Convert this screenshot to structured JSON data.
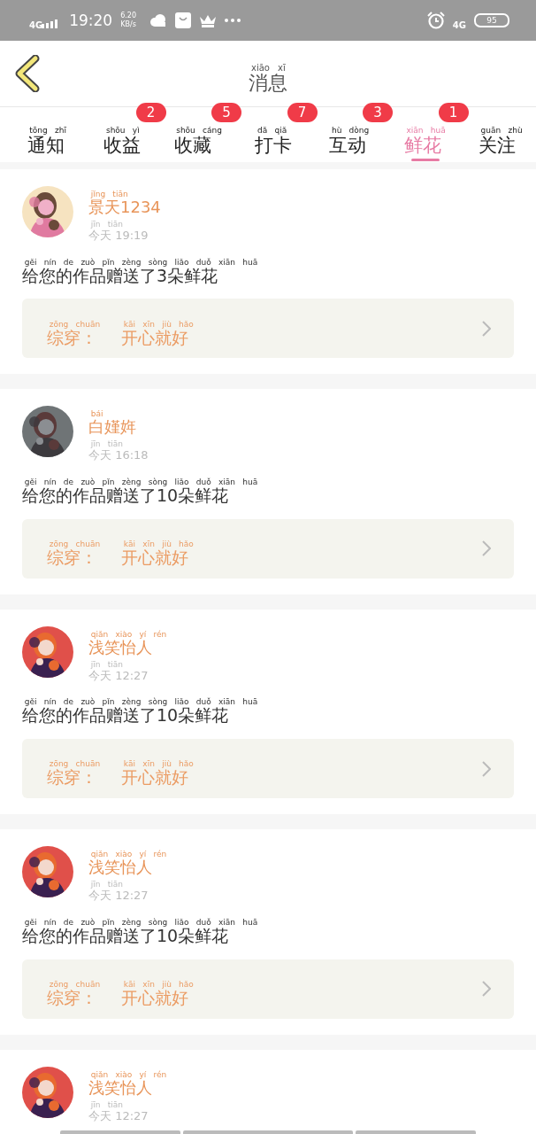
{
  "status_bar": {
    "network": "4G",
    "time": "19:20",
    "speed": "6.20",
    "speed_unit": "KB/s",
    "network_right": "4G",
    "battery": "95"
  },
  "header": {
    "title": "消息",
    "title_pinyin": "xiāo xī"
  },
  "tabs": [
    {
      "label": "通知",
      "pinyin": "tōng zhī",
      "selected": false
    },
    {
      "label": "收益",
      "pinyin": "shōu yì",
      "badge": "2",
      "selected": false
    },
    {
      "label": "收藏",
      "pinyin": "shōu cáng",
      "badge": "5",
      "selected": false
    },
    {
      "label": "打卡",
      "pinyin": "dǎ qiǎ",
      "badge": "7",
      "selected": false
    },
    {
      "label": "互动",
      "pinyin": "hù dòng",
      "badge": "3",
      "selected": false
    },
    {
      "label": "鲜花",
      "pinyin": "xiān huā",
      "badge": "1",
      "selected": true
    },
    {
      "label": "关注",
      "pinyin": "guān zhù",
      "selected": false
    }
  ],
  "messages": [
    {
      "name": "景天1234",
      "name_pinyin": "jǐng tiān",
      "time": "今天 19:19",
      "time_pinyin": "jīn tiān",
      "text": "给您的作品赠送了3朵鲜花",
      "text_pinyin": "gěi nín de zuò pǐn zèng sòng liǎo duǒ xiān huā",
      "work_label": "综穿：",
      "work_label_pinyin": "zōng chuān",
      "work_title": "开心就好",
      "work_title_pinyin": "kāi xīn jiù hǎo"
    },
    {
      "name": "白嫤姩",
      "name_pinyin": "bái",
      "time": "今天 16:18",
      "time_pinyin": "jīn tiān",
      "text": "给您的作品赠送了10朵鲜花",
      "text_pinyin": "gěi nín de zuò pǐn zèng sòng liǎo duǒ xiān huā",
      "work_label": "综穿：",
      "work_label_pinyin": "zōng chuān",
      "work_title": "开心就好",
      "work_title_pinyin": "kāi xīn jiù hǎo"
    },
    {
      "name": "浅笑怡人",
      "name_pinyin": "qiǎn xiào yí rén",
      "time": "今天 12:27",
      "time_pinyin": "jīn tiān",
      "text": "给您的作品赠送了10朵鲜花",
      "text_pinyin": "gěi nín de zuò pǐn zèng sòng liǎo duǒ xiān huā",
      "work_label": "综穿：",
      "work_label_pinyin": "zōng chuān",
      "work_title": "开心就好",
      "work_title_pinyin": "kāi xīn jiù hǎo"
    },
    {
      "name": "浅笑怡人",
      "name_pinyin": "qiǎn xiào yí rén",
      "time": "今天 12:27",
      "time_pinyin": "jīn tiān",
      "text": "给您的作品赠送了10朵鲜花",
      "text_pinyin": "gěi nín de zuò pǐn zèng sòng liǎo duǒ xiān huā",
      "work_label": "综穿：",
      "work_label_pinyin": "zōng chuān",
      "work_title": "开心就好",
      "work_title_pinyin": "kāi xīn jiù hǎo"
    },
    {
      "name": "浅笑怡人",
      "name_pinyin": "qiǎn xiào yí rén",
      "time": "今天 12:27",
      "time_pinyin": "jīn tiān"
    }
  ]
}
